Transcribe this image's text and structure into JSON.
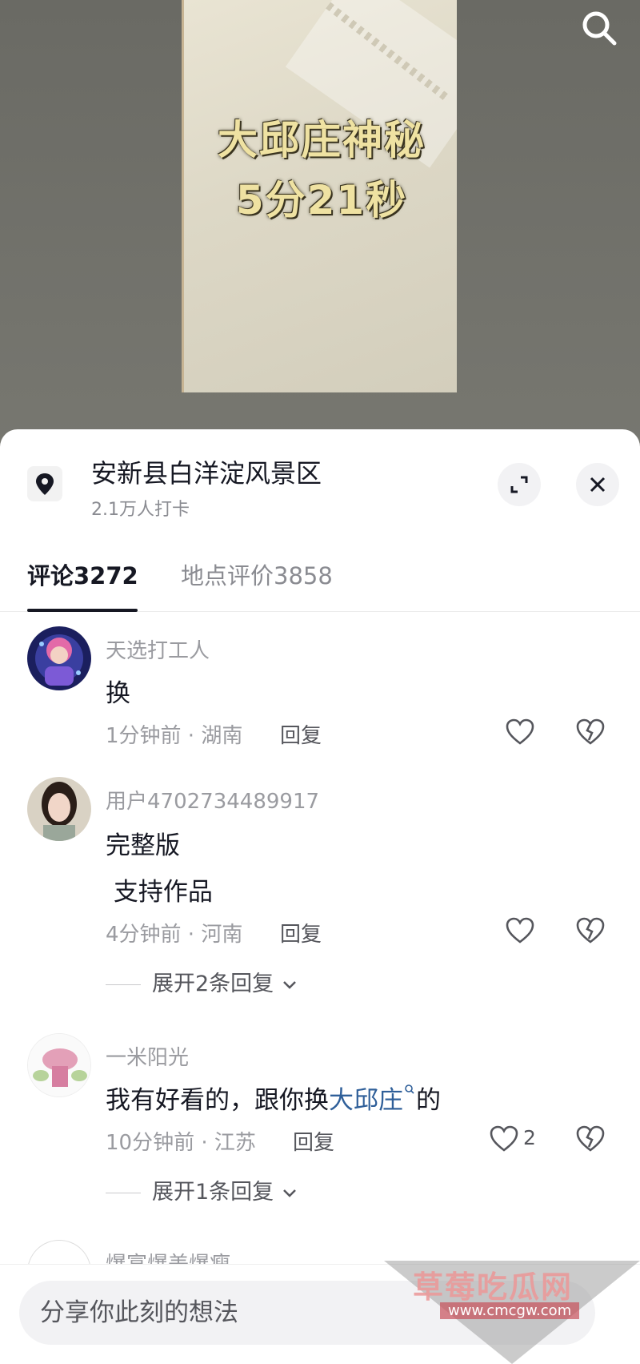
{
  "video": {
    "title_line1": "大邱庄神秘",
    "title_line2": "5分21秒"
  },
  "location": {
    "name": "安新县白洋淀风景区",
    "checkins": "2.1万人打卡"
  },
  "tabs": [
    {
      "label": "评论3272"
    },
    {
      "label": "地点评价3858"
    }
  ],
  "comments": [
    {
      "user": "天选打工人",
      "text": "换",
      "time_region": "1分钟前 · 湖南",
      "reply": "回复"
    },
    {
      "user": "用户4702734489917",
      "text_line1": "完整版",
      "text_line2": " 支持作品",
      "time_region": "4分钟前 · 河南",
      "reply": "回复",
      "expand": "展开2条回复"
    },
    {
      "user": "一米阳光",
      "text_before": "我有好看的，跟你换",
      "text_link": "大邱庄",
      "text_after": "的",
      "time_region": "10分钟前 · 江苏",
      "reply": "回复",
      "likes": "2",
      "expand": "展开1条回复"
    },
    {
      "user": "爆富爆美爆瘦"
    }
  ],
  "input": {
    "placeholder": "分享你此刻的想法"
  },
  "watermark": {
    "text": "草莓吃瓜网",
    "url": "www.cmcgw.com"
  },
  "icons": {
    "search": "search-icon",
    "location": "location-pin-icon",
    "expand": "expand-icon",
    "close": "close-icon",
    "like": "heart-icon",
    "dislike": "broken-heart-icon"
  }
}
